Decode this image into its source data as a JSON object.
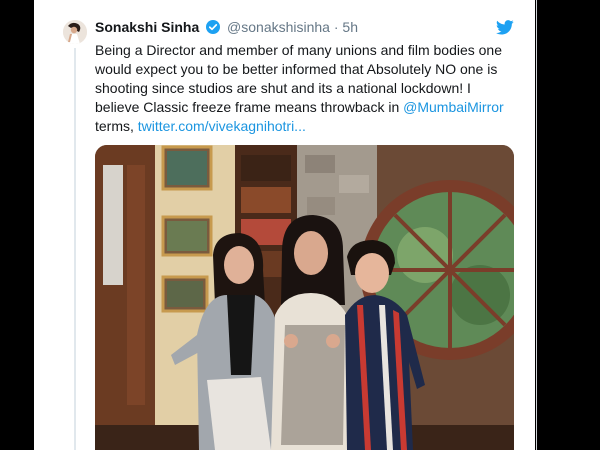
{
  "tweet": {
    "author_name": "Sonakshi Sinha",
    "author_handle": "@sonakshisinha",
    "separator": "·",
    "time": "5h",
    "text_main": "Being a Director and member of many unions and film bodies one would expect you to be better informed that Absolutely NO one is shooting since studios are shut and its a national lockdown! I believe Classic freeze frame means throwback in ",
    "mention": "@MumbaiMirror",
    "text_after_mention": " terms, ",
    "link": "twitter.com/vivekagnihotri...",
    "media_alt": "Photo of three people posing on a TV show set"
  },
  "colors": {
    "background": "#000000",
    "card": "#ffffff",
    "text": "#14171a",
    "secondary_text": "#657786",
    "link": "#1b95e0",
    "twitter_blue": "#1da1f2"
  },
  "icons": [
    "avatar",
    "verified-badge-icon",
    "twitter-bird-icon"
  ]
}
